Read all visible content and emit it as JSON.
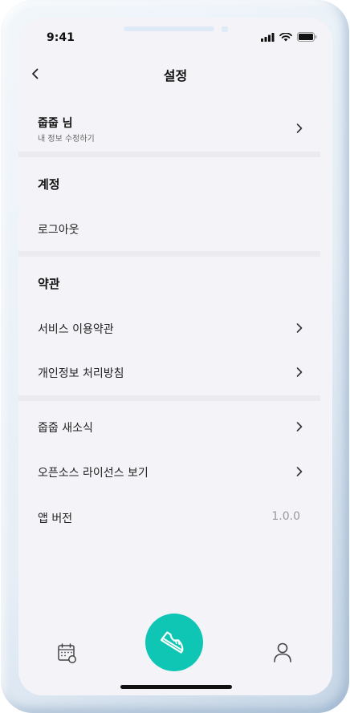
{
  "status_bar": {
    "time": "9:41",
    "icons": [
      "signal-icon",
      "wifi-icon",
      "battery-icon"
    ]
  },
  "header": {
    "title": "설정",
    "back_icon": "chevron-left-icon"
  },
  "profile": {
    "name": "줍줍 님",
    "subtitle": "내 정보 수정하기"
  },
  "account_section": {
    "title": "계정",
    "items": [
      {
        "label": "로그아웃"
      }
    ]
  },
  "terms_section": {
    "title": "약관",
    "items": [
      {
        "label": "서비스 이용약관"
      },
      {
        "label": "개인정보 처리방침"
      }
    ]
  },
  "misc_section": {
    "items": [
      {
        "label": "줍줍 새소식"
      },
      {
        "label": "오픈소스 라이선스 보기"
      }
    ],
    "version": {
      "label": "앱 버전",
      "value": "1.0.0"
    }
  },
  "bottom_nav": {
    "items": [
      "calendar-icon",
      "sneaker-icon",
      "user-icon"
    ],
    "accent_color": "#0fc6b5"
  }
}
